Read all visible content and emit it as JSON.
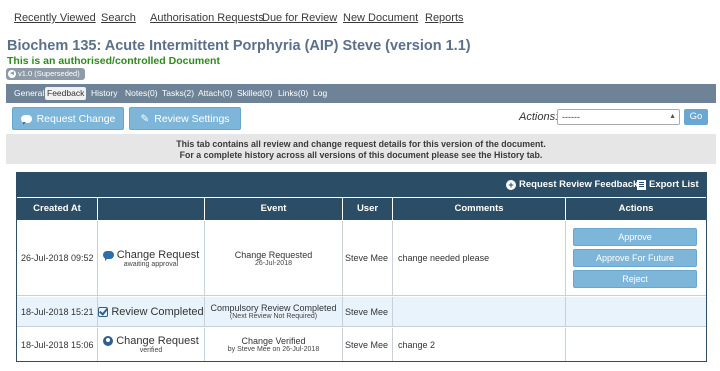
{
  "topnav": [
    "Recently Viewed",
    "Search",
    "Authorisation Requests",
    "Due for Review",
    "New Document",
    "Reports"
  ],
  "document": {
    "title": "Biochem 135: Acute Intermittent Porphyria (AIP) Steve (version 1.1)",
    "subtitle": "This is an authorised/controlled Document",
    "version_badge": "v1.0 (Superseded)"
  },
  "tabs": [
    "General",
    "Feedback",
    "History",
    "Notes(0)",
    "Tasks(2)",
    "Attach(0)",
    "Skilled(0)",
    "Links(0)",
    "Log"
  ],
  "active_tab": "Feedback",
  "toolbar": {
    "request_change": "Request Change",
    "review_settings": "Review Settings",
    "actions_label": "Actions:",
    "actions_value": "------",
    "go": "Go"
  },
  "info": {
    "line1": "This tab contains all review and change request details for this version of the document.",
    "line2": "For a complete history across all versions of this document please see the History tab."
  },
  "panel": {
    "request_review_feedback": "Request Review Feedback",
    "export_list": "Export List"
  },
  "columns": [
    "Created At",
    "Event",
    "User",
    "Comments",
    "Actions"
  ],
  "rows": [
    {
      "created": "26-Jul-2018 09:52",
      "type": "Change Request",
      "type_sub": "awaiting approval",
      "event": "Change Requested",
      "event_sub": "26-Jul-2018",
      "user": "Steve Mee",
      "comment": "change needed please",
      "actions": [
        "Approve",
        "Approve For Future",
        "Reject"
      ]
    },
    {
      "created": "18-Jul-2018 15:21",
      "type": "Review Completed",
      "type_sub": "",
      "event": "Compulsory Review Completed",
      "event_sub": "(Next Review Not Required)",
      "user": "Steve Mee",
      "comment": ""
    },
    {
      "created": "18-Jul-2018 15:06",
      "type": "Change Request",
      "type_sub": "verified",
      "event": "Change Verified",
      "event_sub": "by Steve Mee on 26-Jul-2018",
      "user": "Steve Mee",
      "comment": "change 2"
    }
  ],
  "colors": {
    "title": "#5b7089",
    "subtitle": "#2f8a1c",
    "tabbar": "#6e8397",
    "panel_header": "#2b4d65",
    "button": "#7eb6d9",
    "highlight_row": "#e9f3fb"
  }
}
